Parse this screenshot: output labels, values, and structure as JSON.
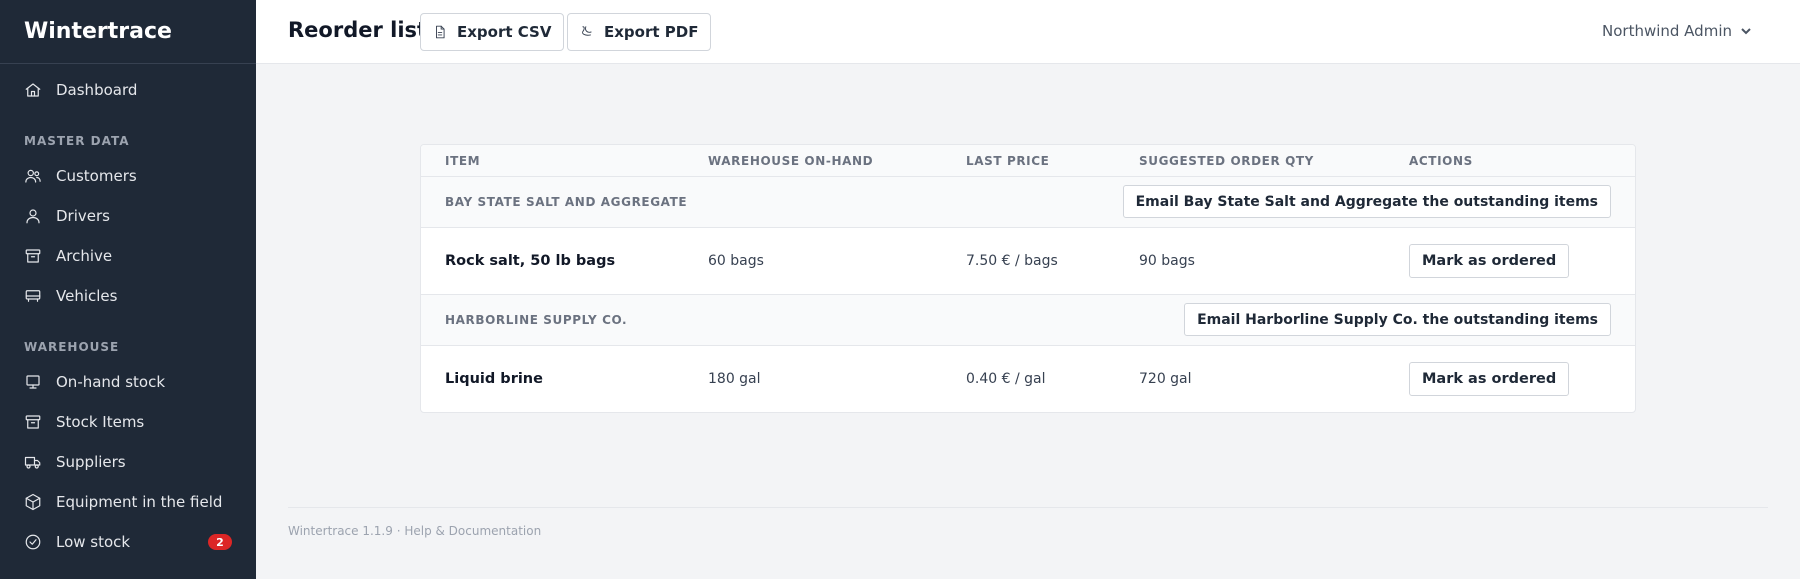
{
  "sidebar": {
    "brand": "Wintertrace",
    "top_items": [
      {
        "label": "Dashboard",
        "icon": "home-icon"
      }
    ],
    "sections": [
      {
        "label": "MASTER DATA",
        "items": [
          {
            "label": "Customers",
            "icon": "users-icon"
          },
          {
            "label": "Drivers",
            "icon": "user-icon"
          },
          {
            "label": "Archive",
            "icon": "archive-icon"
          },
          {
            "label": "Vehicles",
            "icon": "vehicle-icon"
          }
        ]
      },
      {
        "label": "WAREHOUSE",
        "items": [
          {
            "label": "On-hand stock",
            "icon": "monitor-icon"
          },
          {
            "label": "Stock Items",
            "icon": "archive-icon"
          },
          {
            "label": "Suppliers",
            "icon": "truck-icon"
          },
          {
            "label": "Equipment in the field",
            "icon": "box-icon"
          },
          {
            "label": "Low stock",
            "icon": "check-circle-icon",
            "badge": "2"
          }
        ]
      }
    ]
  },
  "header": {
    "title": "Reorder list",
    "export_csv": "Export CSV",
    "export_pdf": "Export PDF",
    "user": "Northwind Admin"
  },
  "table": {
    "columns": [
      "ITEM",
      "WAREHOUSE ON-HAND",
      "LAST PRICE",
      "SUGGESTED ORDER QTY",
      "ACTIONS"
    ],
    "groups": [
      {
        "supplier": "BAY STATE SALT AND AGGREGATE",
        "email_label": "Email Bay State Salt and Aggregate the outstanding items",
        "items": [
          {
            "name": "Rock salt, 50 lb bags",
            "on_hand": "60 bags",
            "price": "7.50 € / bags",
            "qty": "90 bags",
            "action": "Mark as ordered"
          }
        ]
      },
      {
        "supplier": "HARBORLINE SUPPLY CO.",
        "email_label": "Email Harborline Supply Co. the outstanding items",
        "items": [
          {
            "name": "Liquid brine",
            "on_hand": "180 gal",
            "price": "0.40 € / gal",
            "qty": "720 gal",
            "action": "Mark as ordered"
          }
        ]
      }
    ]
  },
  "footer": {
    "text": "Wintertrace 1.1.9 · Help & Documentation"
  }
}
